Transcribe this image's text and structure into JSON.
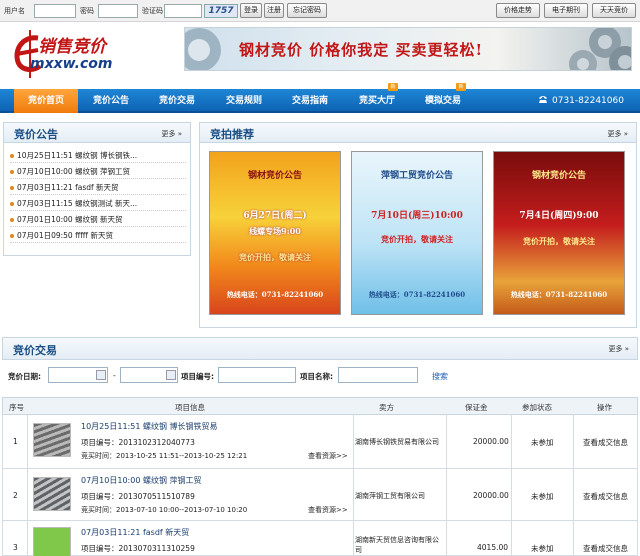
{
  "topbar": {
    "username_label": "用户名",
    "password_label": "密码",
    "captcha_label": "验证码",
    "captcha_value": "1757",
    "login_button": "登录",
    "register_button": "注册",
    "forgot_button": "忘记密码",
    "right_buttons": [
      "价格走势",
      "电子期刊",
      "天天竞价"
    ]
  },
  "logo": {
    "text": "销售竞价",
    "domain": "mxxw.com"
  },
  "banner": {
    "text": "钢材竞价 价格你我定 买卖更轻松!"
  },
  "nav": {
    "items": [
      "竞价首页",
      "竞价公告",
      "竞价交易",
      "交易规则",
      "交易指南",
      "竞买大厅",
      "模拟交易"
    ],
    "hot_badge": "新",
    "phone": "0731-82241060"
  },
  "announcements": {
    "title": "竞价公告",
    "more": "更多",
    "items": [
      "10月25日11:51 螺纹钢 博长钢铁...",
      "07月10日10:00 螺纹钢 萍钢工贸",
      "07月03日11:21 fasdf 新天贸",
      "07月03日11:15 螺纹钢测试 新天...",
      "07月01日10:00 螺纹钢 新天贸",
      "07月01日09:50 fffff 新天贸"
    ]
  },
  "recommend": {
    "title": "竞拍推荐",
    "more": "更多",
    "posters": [
      {
        "title": "钢材竞价公告",
        "date": "6月27日(周二)",
        "line3": "线螺专场9:00",
        "line4": "竞价开拍，敬请关注",
        "hotline": "热线电话：0731-82241060"
      },
      {
        "title": "萍钢工贸竞价公告",
        "date": "7月10日(周三)10:00",
        "line3": "竞价开拍，敬请关注",
        "line4": "",
        "hotline": "热线电话：0731-82241060"
      },
      {
        "title": "钢材竞价公告",
        "date": "7月4日(周四)9:00",
        "line3": "竞价开拍，敬请关注",
        "line4": "",
        "hotline": "热线电话：0731-82241060"
      }
    ]
  },
  "trading": {
    "title": "竞价交易",
    "more": "更多",
    "date_label": "竞价日期:",
    "date_sep": "-",
    "item_no_label": "项目编号:",
    "item_name_label": "项目名称:",
    "search_button": "搜索",
    "columns": [
      "序号",
      "项目信息",
      "卖方",
      "保证金",
      "参加状态",
      "操作"
    ],
    "rows": [
      {
        "no": "1",
        "title": "10月25日11:51 螺纹钢 博长钢铁贸易",
        "code": "项目编号：2013102312040773",
        "time": "竞买时间：2013-10-25 11:51--2013-10-25 12:21",
        "view": "查看资源>>",
        "seller": "湖南博长钢铁贸易有限公司",
        "deposit": "20000.00",
        "status": "未参加",
        "op": "查看成交信息"
      },
      {
        "no": "2",
        "title": "07月10日10:00 螺纹钢 萍钢工贸",
        "code": "项目编号：2013070511510789",
        "time": "竞买时间：2013-07-10 10:00--2013-07-10 10:20",
        "view": "查看资源>>",
        "seller": "湖南萍钢工贸有限公司",
        "deposit": "20000.00",
        "status": "未参加",
        "op": "查看成交信息"
      },
      {
        "no": "3",
        "title": "07月03日11:21 fasdf 新天贸",
        "code": "项目编号：2013070311310259",
        "time": "",
        "view": "",
        "seller": "湖南新天贸信息咨询有限公司",
        "deposit": "4015.00",
        "status": "未参加",
        "op": "查看成交信息"
      }
    ]
  },
  "colors": {
    "nav_blue": "#1279c8",
    "nav_active": "#f08a1c",
    "accent_red": "#c21616"
  }
}
